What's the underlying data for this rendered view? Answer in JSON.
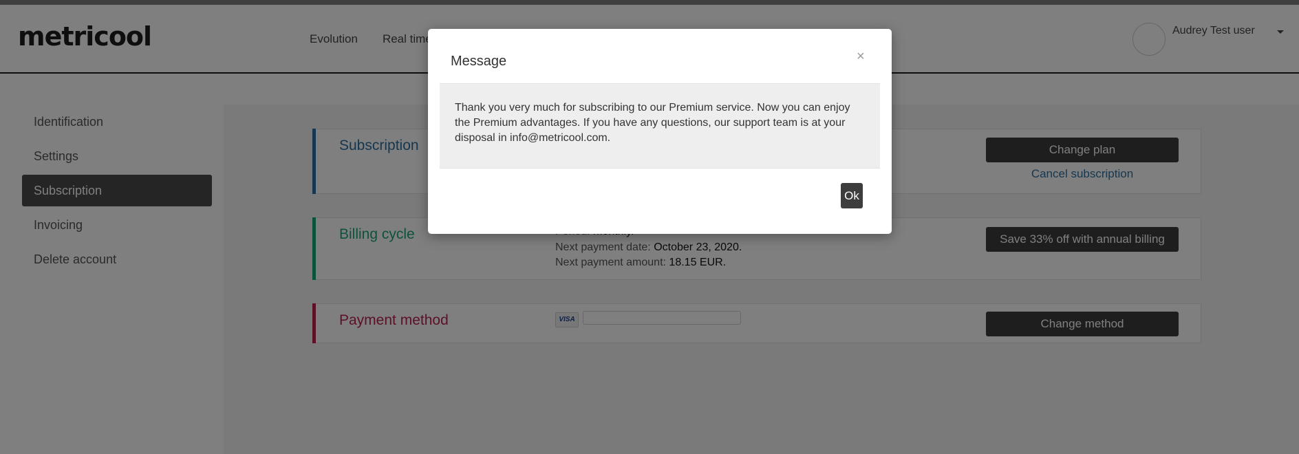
{
  "header": {
    "logo": "metricool",
    "nav": [
      "Evolution",
      "Real time"
    ],
    "user": {
      "name": "Audrey Test user"
    }
  },
  "sidebar": {
    "items": [
      {
        "label": "Identification"
      },
      {
        "label": "Settings"
      },
      {
        "label": "Subscription",
        "active": true
      },
      {
        "label": "Invoicing"
      },
      {
        "label": "Delete account"
      }
    ]
  },
  "subscription": {
    "title": "Subscription",
    "change_plan": "Change plan",
    "cancel": "Cancel subscription"
  },
  "billing": {
    "title": "Billing cycle",
    "period_label": "Period:",
    "period_value": "monthly.",
    "next_date_label": "Next payment date:",
    "next_date_value": "October 23, 2020.",
    "next_amount_label": "Next payment amount:",
    "next_amount_value": "18.15 EUR.",
    "annual_button": "Save 33% off with annual billing"
  },
  "payment": {
    "title": "Payment method",
    "card_brand": "VISA",
    "change_button": "Change method"
  },
  "modal": {
    "title": "Message",
    "close": "×",
    "body": "Thank you very much for subscribing to our Premium service. Now you can enjoy the Premium advantages. If you have any questions, our support team is at your disposal in info@metricool.com.",
    "ok": "Ok"
  },
  "colors": {
    "subscription_accent": "#2d6f9e",
    "billing_accent": "#1aa47a",
    "payment_accent": "#b8234f",
    "dark_button": "#3d3d3d"
  }
}
